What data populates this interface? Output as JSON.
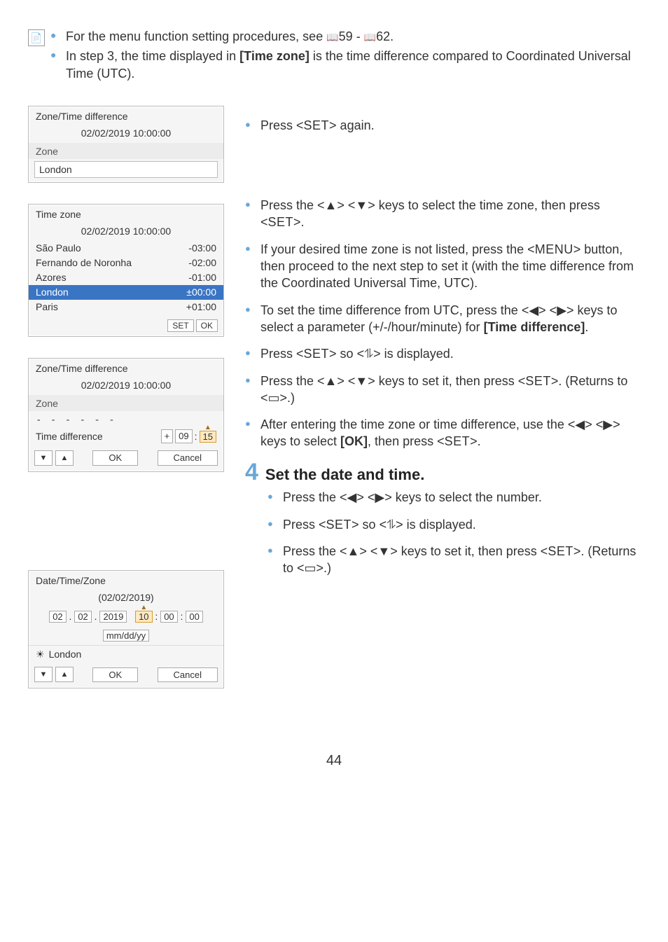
{
  "note": {
    "line1a": "For the menu function setting procedures, see ",
    "ref1": "59",
    "ref_sep": " - ",
    "ref2": "62",
    "line1b": ".",
    "line2a": "In step 3, the time displayed in ",
    "line2bold": "[Time zone]",
    "line2b": " is the time difference compared to Coordinated Universal Time (UTC)."
  },
  "dialog1": {
    "title": "Zone/Time difference",
    "datetime": "02/02/2019 10:00:00",
    "zone_label": "Zone",
    "zone_value": "London"
  },
  "dialog2": {
    "title": "Time zone",
    "datetime": "02/02/2019 10:00:00",
    "rows": [
      {
        "city": "São Paulo",
        "off": "-03:00"
      },
      {
        "city": "Fernando de Noronha",
        "off": "-02:00"
      },
      {
        "city": "Azores",
        "off": "-01:00"
      },
      {
        "city": "London",
        "off": "±00:00",
        "hl": true
      },
      {
        "city": "Paris",
        "off": "+01:00"
      }
    ],
    "set_label": "SET",
    "ok_label": "OK"
  },
  "dialog3": {
    "title": "Zone/Time difference",
    "datetime": "02/02/2019 10:00:00",
    "zone_label": "Zone",
    "dash": "- - - - - -",
    "diff_label": "Time difference",
    "sign": "+",
    "hour": "09",
    "min": "15",
    "ok": "OK",
    "cancel": "Cancel"
  },
  "dialog4": {
    "title": "Date/Time/Zone",
    "date": "(02/02/2019)",
    "d1": "02",
    "d2": "02",
    "d3": "2019",
    "t1": "10",
    "t2": "00",
    "t3": "00",
    "format": "mm/dd/yy",
    "zone": "London",
    "ok": "OK",
    "cancel": "Cancel"
  },
  "right": {
    "r1a": "Press <",
    "set": "SET",
    "r1b": "> again.",
    "b1": "Press the <▲> <▼> keys to select the time zone, then press <",
    "b1b": ">.",
    "b2a": "If your desired time zone is not listed, press the <",
    "menu": "MENU",
    "b2b": "> button, then proceed to the next step to set it (with the time difference from the Coordinated Universal Time, UTC).",
    "b3a": "To set the time difference from UTC, press the <◀> <▶> keys to select a parameter (+/-/hour/minute) for ",
    "b3bold": "[Time difference]",
    "b3b": ".",
    "b4a": "Press <",
    "b4b": "> so <⥮> is displayed.",
    "b5a": "Press the <▲> <▼> keys to set it, then press <",
    "b5b": ">. (Returns to <▭>.)",
    "b6a": "After entering the time zone or time difference, use the <◀> <▶> keys to select ",
    "b6bold": "[OK]",
    "b6b": ", then press <",
    "b6c": ">."
  },
  "step4": {
    "num": "4",
    "title": "Set the date and time.",
    "s1": "Press the <◀> <▶> keys to select the number.",
    "s2a": "Press <",
    "s2b": "> so <⥮> is displayed.",
    "s3a": "Press the <▲> <▼> keys to set it, then press <",
    "s3b": ">. (Returns to <▭>.)"
  },
  "page": "44"
}
